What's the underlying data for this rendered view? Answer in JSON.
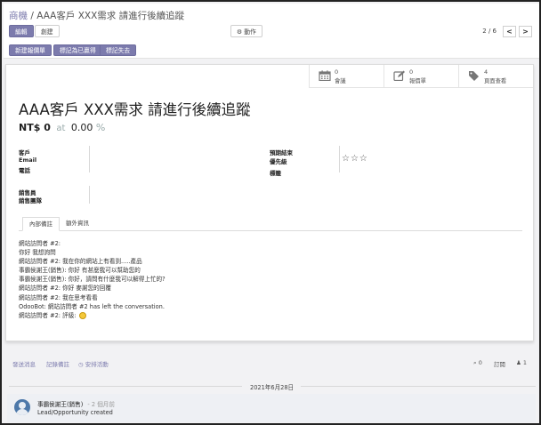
{
  "breadcrumb": {
    "parent": "商機",
    "separator": "/",
    "current": "AAA客戶 XXX需求 請進行後續追蹤"
  },
  "toolbar": {
    "edit": "編輯",
    "create": "創建",
    "action": "動作"
  },
  "pager": {
    "value": "2 / 6",
    "prev": "<",
    "next": ">"
  },
  "status_buttons": {
    "new_quotation": "新建報價單",
    "mark_won": "標記為已贏得",
    "mark_lost": "標記失去"
  },
  "smart_buttons": [
    {
      "count": "0",
      "label": "會議",
      "icon": "calendar-icon"
    },
    {
      "count": "0",
      "label": "報價單",
      "icon": "pencil-square-icon"
    },
    {
      "count": "4",
      "label": "頁面查看",
      "icon": "tags-icon"
    }
  ],
  "lead": {
    "title": "AAA客戶 XXX需求 請進行後續追蹤",
    "revenue": "NT$ 0",
    "at": "at",
    "probability": "0.00",
    "percent": "%"
  },
  "fields": {
    "customer": "客戶",
    "email": "Email",
    "phone": "電話",
    "expected_closing": "預期結束",
    "priority": "優先級",
    "tags": "標籤",
    "salesperson": "銷售員",
    "sales_team": "銷售團隊",
    "priority_stars": "☆☆☆"
  },
  "tabs": {
    "internal_notes": "內部備註",
    "extra_info": "額外資訊"
  },
  "notes": [
    "網站訪問者 #2:",
    "你好 我想詢問",
    "網站訪問者 #2: 我在你的網站上有看到.....產品",
    "事霸侯謝王(銷售): 你好 有甚麼我可以幫助您的",
    "事霸侯謝王(銷售): 你好，請問有什麼我可以解得上忙的?",
    "網站訪問者 #2: 你好 麥謝您的回覆",
    "網站訪問者 #2: 我在思考看看",
    "OdooBot: 網站訪問者 #2 has left the conversation.",
    "網站訪問者 #2: 評級:"
  ],
  "chatter": {
    "send_message": "發送消息",
    "log_note": "記錄備註",
    "schedule_activity": "安排活動",
    "attachments": "0",
    "follow": "訂閱",
    "followers": "1",
    "date_separator": "2021年6月28日"
  },
  "message": {
    "author": "事霸侯謝王(銷售)",
    "time_ago": "- 2 個月前",
    "body": "Lead/Opportunity created"
  },
  "colors": {
    "primary": "#7c7bad",
    "background": "#f2f2f4",
    "sheet": "#ffffff"
  }
}
